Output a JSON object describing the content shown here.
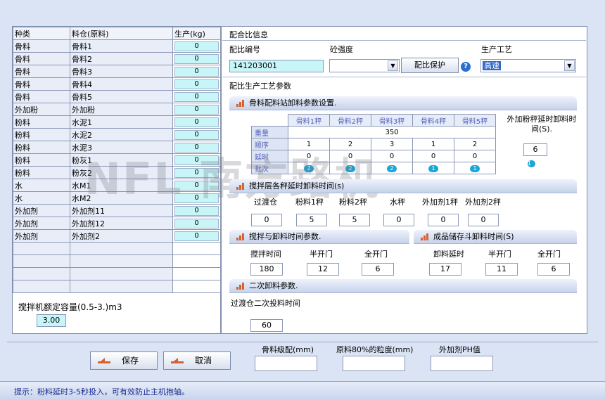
{
  "left_table": {
    "headers": [
      "种类",
      "料仓(原料)",
      "生产(kg)"
    ],
    "rows": [
      {
        "type": "骨料",
        "bin": "骨料1",
        "prod": "0"
      },
      {
        "type": "骨料",
        "bin": "骨料2",
        "prod": "0"
      },
      {
        "type": "骨料",
        "bin": "骨料3",
        "prod": "0"
      },
      {
        "type": "骨料",
        "bin": "骨料4",
        "prod": "0"
      },
      {
        "type": "骨料",
        "bin": "骨料5",
        "prod": "0"
      },
      {
        "type": "外加粉",
        "bin": "外加粉",
        "prod": "0"
      },
      {
        "type": "粉料",
        "bin": "水泥1",
        "prod": "0"
      },
      {
        "type": "粉料",
        "bin": "水泥2",
        "prod": "0"
      },
      {
        "type": "粉料",
        "bin": "水泥3",
        "prod": "0"
      },
      {
        "type": "粉料",
        "bin": "粉灰1",
        "prod": "0"
      },
      {
        "type": "粉料",
        "bin": "粉灰2",
        "prod": "0"
      },
      {
        "type": "水",
        "bin": "水M1",
        "prod": "0"
      },
      {
        "type": "水",
        "bin": "水M2",
        "prod": "0"
      },
      {
        "type": "外加剂",
        "bin": "外加剂11",
        "prod": "0"
      },
      {
        "type": "外加剂",
        "bin": "外加剂12",
        "prod": "0"
      },
      {
        "type": "外加剂",
        "bin": "外加剂2",
        "prod": "0"
      }
    ],
    "capacity_label": "搅拌机额定容量(0.5-3.)m3",
    "capacity_value": "3.00"
  },
  "mix_info": {
    "title": "配合比信息",
    "code_label": "配比编号",
    "code_value": "141203001",
    "strength_label": "砼强度",
    "strength_value": "",
    "protect_button": "配比保护",
    "help_icon": "?",
    "process_label": "生产工艺",
    "process_value": "高速"
  },
  "process_params_title": "配比生产工艺参数",
  "aggregate": {
    "title": "骨料配料站卸料参数设置.",
    "columns": [
      "骨料1秤",
      "骨料2秤",
      "骨料3秤",
      "骨料4秤",
      "骨料5秤"
    ],
    "row_labels": [
      "重量",
      "顺序",
      "延时",
      "批次"
    ],
    "weight": "350",
    "order": [
      "1",
      "2",
      "3",
      "1",
      "2"
    ],
    "delay": [
      "0",
      "0",
      "0",
      "0",
      "0"
    ],
    "batch": [
      "2",
      "2",
      "2",
      "1",
      "1"
    ],
    "powder_delay_label": "外加粉秤延时卸料时间(S).",
    "powder_delay_value": "6",
    "powder_batch": "1"
  },
  "mixer_layer": {
    "title": "搅拌层各秤延时卸料时间(s)",
    "labels": [
      "过渡仓",
      "粉料1秤",
      "粉料2秤",
      "水秤",
      "外加剂1秤",
      "外加剂2秤"
    ],
    "values": [
      "0",
      "5",
      "5",
      "0",
      "0",
      "0"
    ]
  },
  "mix_discharge": {
    "title": "搅拌与卸料时间参数.",
    "labels": [
      "搅拌时间",
      "半开门",
      "全开门"
    ],
    "values": [
      "180",
      "12",
      "6"
    ]
  },
  "storage": {
    "title": "成品储存斗卸料时间(S)",
    "labels": [
      "卸料延时",
      "半开门",
      "全开门"
    ],
    "values": [
      "17",
      "11",
      "6"
    ]
  },
  "secondary": {
    "title": "二次卸料参数.",
    "label": "过渡仓二次投料时间",
    "value": "60"
  },
  "bottom": {
    "save": "保存",
    "cancel": "取消",
    "f1_label": "骨料级配(mm)",
    "f1_value": "",
    "f2_label": "原料80%的粒度(mm)",
    "f2_value": "",
    "f3_label": "外加剂PH值",
    "f3_value": ""
  },
  "status_tip": "提示：粉料延时3-5秒投入，可有效防止主机抱轴。",
  "watermark_text": "NFL 南方路机",
  "colors": {
    "accent": "#19a6d8",
    "prod_bg": "#c8f6f8",
    "section_icon": "#d9612b"
  }
}
